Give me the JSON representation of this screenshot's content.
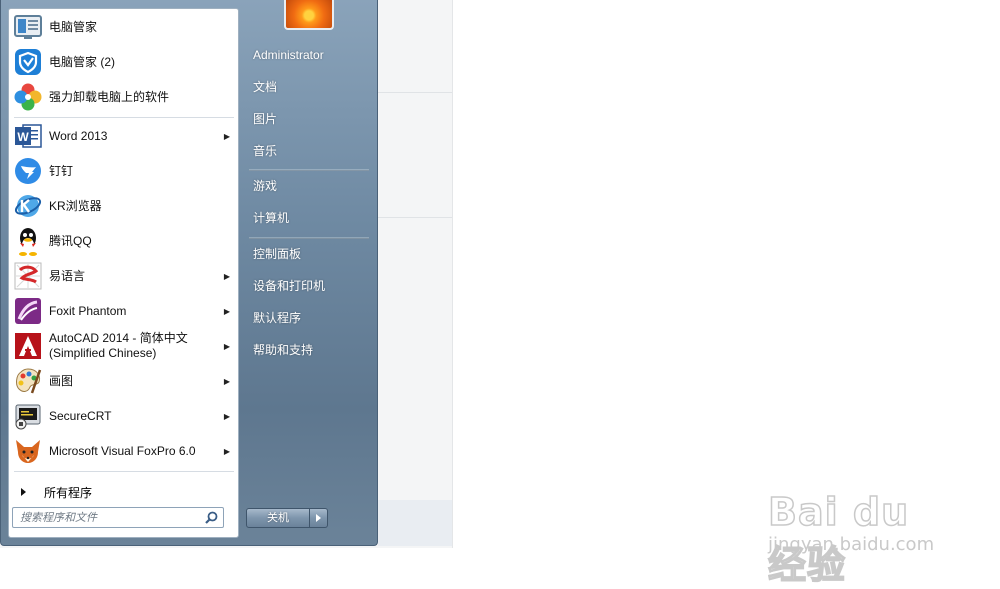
{
  "programs": [
    {
      "label": "电脑管家",
      "icon": "pc-manager-icon",
      "arrow": false
    },
    {
      "label": "电脑管家 (2)",
      "icon": "tencent-shield-icon",
      "arrow": false
    },
    {
      "label": "强力卸载电脑上的软件",
      "icon": "uninstall-flower-icon",
      "arrow": false
    },
    {
      "label": "Word 2013",
      "icon": "word-icon",
      "arrow": true
    },
    {
      "label": "钉钉",
      "icon": "dingtalk-icon",
      "arrow": false
    },
    {
      "label": "KR浏览器",
      "icon": "kr-browser-icon",
      "arrow": false
    },
    {
      "label": "腾讯QQ",
      "icon": "qq-penguin-icon",
      "arrow": false
    },
    {
      "label": "易语言",
      "icon": "eyuyan-icon",
      "arrow": true
    },
    {
      "label": "Foxit Phantom",
      "icon": "foxit-icon",
      "arrow": true
    },
    {
      "label": "AutoCAD 2014 - 简体中文 (Simplified Chinese)",
      "icon": "autocad-icon",
      "arrow": true
    },
    {
      "label": "画图",
      "icon": "paint-palette-icon",
      "arrow": true
    },
    {
      "label": "SecureCRT",
      "icon": "securecrt-icon",
      "arrow": true
    },
    {
      "label": "Microsoft Visual FoxPro 6.0",
      "icon": "foxpro-icon",
      "arrow": true
    }
  ],
  "all_programs": "所有程序",
  "search": {
    "placeholder": "搜索程序和文件"
  },
  "right_links": [
    "Administrator",
    "文档",
    "图片",
    "音乐",
    "游戏",
    "计算机",
    "控制面板",
    "设备和打印机",
    "默认程序",
    "帮助和支持"
  ],
  "shutdown": {
    "label": "关机"
  },
  "watermark": {
    "logo": "Bai du 经验",
    "sub": "jingyan.baidu.com"
  }
}
